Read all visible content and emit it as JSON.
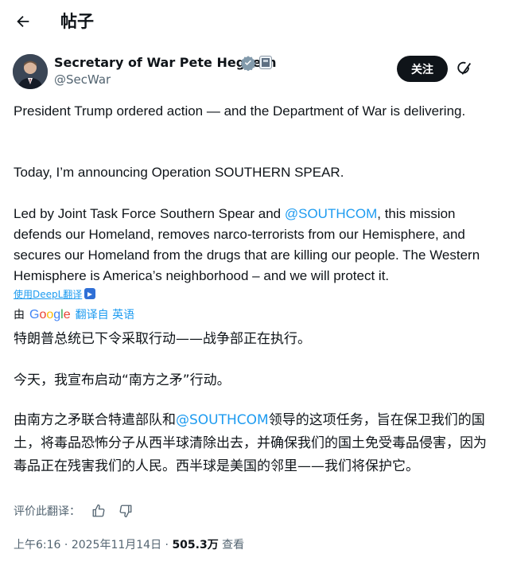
{
  "header": {
    "back_icon": "arrow-left-icon",
    "title": "帖子"
  },
  "author": {
    "name": "Secretary of War Pete Hegseth",
    "handle": "@SecWar",
    "verified_icon": "verified-badge-icon",
    "verified_color": "#829aab"
  },
  "actions": {
    "follow_label": "关注",
    "more_icon": "grok-icon"
  },
  "tweet": {
    "p1": "President Trump ordered action — and the Department of War is delivering.",
    "p2": "Today, I’m announcing Operation SOUTHERN SPEAR.",
    "p3_before": "Led by Joint Task Force Southern Spear and ",
    "p3_mention": "@SOUTHCOM",
    "p3_after": ", this mission defends our Homeland, removes narco-terrorists from our Hemisphere, and secures our Homeland from the drugs that are killing our people. The Western Hemisphere is America’s neighborhood – and we will protect it."
  },
  "translation": {
    "deepl_link": "使用DeepL翻译",
    "by": "由",
    "google": "Google",
    "translated_from": "翻译自 英语",
    "p1": "特朗普总统已下令采取行动——战争部正在执行。",
    "p2": "今天，我宣布启动“南方之矛”行动。",
    "p3_before": "由南方之矛联合特遣部队和",
    "p3_mention": "@SOUTHCOM",
    "p3_after": "领导的这项任务，旨在保卫我们的国土，将毒品恐怖分子从西半球清除出去，并确保我们的国土免受毒品侵害，因为毒品正在残害我们的人民。西半球是美国的邻里——我们将保护它。",
    "rate_label": "评价此翻译："
  },
  "meta": {
    "time": "上午6:16",
    "sep1": " · ",
    "date": "2025年11月14日",
    "sep2": " · ",
    "views_count": "505.3万",
    "views_label": " 查看"
  },
  "colors": {
    "accent": "#1d9bf0",
    "text": "#0f1419",
    "secondary": "#536471"
  }
}
